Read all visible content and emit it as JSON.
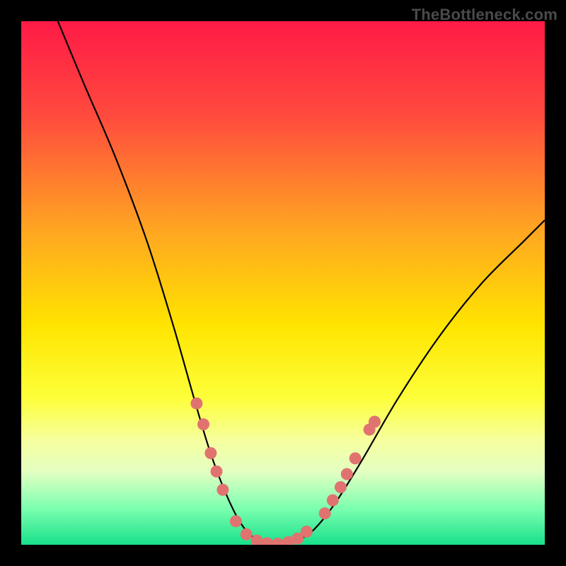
{
  "watermark": "TheBottleneck.com",
  "chart_data": {
    "type": "line",
    "title": "",
    "xlabel": "",
    "ylabel": "",
    "xlim": [
      0,
      100
    ],
    "ylim": [
      0,
      100
    ],
    "background_gradient": {
      "stops": [
        {
          "offset": 0.0,
          "color": "#ff1a46"
        },
        {
          "offset": 0.18,
          "color": "#ff4a3e"
        },
        {
          "offset": 0.4,
          "color": "#ffa621"
        },
        {
          "offset": 0.58,
          "color": "#ffe400"
        },
        {
          "offset": 0.72,
          "color": "#fdff3a"
        },
        {
          "offset": 0.8,
          "color": "#f6ff9e"
        },
        {
          "offset": 0.86,
          "color": "#e4ffc2"
        },
        {
          "offset": 0.93,
          "color": "#7cffb0"
        },
        {
          "offset": 1.0,
          "color": "#18e08a"
        }
      ]
    },
    "series": [
      {
        "name": "bottleneck-curve",
        "style": "line",
        "color": "#000000",
        "points": [
          {
            "x": 7,
            "y": 100
          },
          {
            "x": 12,
            "y": 88
          },
          {
            "x": 18,
            "y": 74
          },
          {
            "x": 24,
            "y": 58
          },
          {
            "x": 29,
            "y": 42
          },
          {
            "x": 33,
            "y": 28
          },
          {
            "x": 36,
            "y": 18
          },
          {
            "x": 39,
            "y": 10
          },
          {
            "x": 42,
            "y": 4
          },
          {
            "x": 45,
            "y": 1
          },
          {
            "x": 49,
            "y": 0
          },
          {
            "x": 53,
            "y": 1
          },
          {
            "x": 56,
            "y": 3
          },
          {
            "x": 60,
            "y": 8
          },
          {
            "x": 65,
            "y": 16
          },
          {
            "x": 72,
            "y": 28
          },
          {
            "x": 80,
            "y": 40
          },
          {
            "x": 88,
            "y": 50
          },
          {
            "x": 96,
            "y": 58
          },
          {
            "x": 100,
            "y": 62
          }
        ]
      },
      {
        "name": "marker-dots",
        "style": "scatter",
        "color": "#e0736f",
        "points": [
          {
            "x": 33.5,
            "y": 27
          },
          {
            "x": 34.8,
            "y": 23
          },
          {
            "x": 36.2,
            "y": 17.5
          },
          {
            "x": 37.3,
            "y": 14
          },
          {
            "x": 38.5,
            "y": 10.5
          },
          {
            "x": 41.0,
            "y": 4.5
          },
          {
            "x": 43.0,
            "y": 2
          },
          {
            "x": 45.0,
            "y": 0.8
          },
          {
            "x": 47.0,
            "y": 0.3
          },
          {
            "x": 49.0,
            "y": 0.2
          },
          {
            "x": 51.0,
            "y": 0.5
          },
          {
            "x": 52.8,
            "y": 1.2
          },
          {
            "x": 54.5,
            "y": 2.5
          },
          {
            "x": 58.0,
            "y": 6
          },
          {
            "x": 59.5,
            "y": 8.5
          },
          {
            "x": 61.0,
            "y": 11
          },
          {
            "x": 62.2,
            "y": 13.5
          },
          {
            "x": 63.8,
            "y": 16.5
          },
          {
            "x": 66.5,
            "y": 22
          },
          {
            "x": 67.5,
            "y": 23.5
          }
        ]
      }
    ]
  }
}
